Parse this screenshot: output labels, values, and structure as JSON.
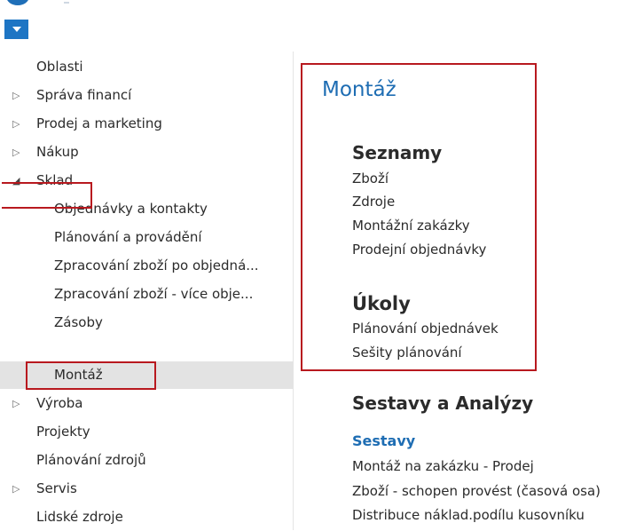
{
  "nav": {
    "items": [
      {
        "label": "Oblasti",
        "arrow": ""
      },
      {
        "label": "Správa financí",
        "arrow": "▷"
      },
      {
        "label": "Prodej a marketing",
        "arrow": "▷"
      },
      {
        "label": "Nákup",
        "arrow": "▷"
      },
      {
        "label": "Sklad",
        "arrow": "◢"
      },
      {
        "label": "Objednávky a kontakty",
        "arrow": ""
      },
      {
        "label": "Plánování a provádění",
        "arrow": ""
      },
      {
        "label": "Zpracování zboží po objedná...",
        "arrow": ""
      },
      {
        "label": "Zpracování zboží - více obje...",
        "arrow": ""
      },
      {
        "label": "Zásoby",
        "arrow": ""
      },
      {
        "label": "Montáž",
        "arrow": ""
      },
      {
        "label": "Výroba",
        "arrow": "▷"
      },
      {
        "label": "Projekty",
        "arrow": ""
      },
      {
        "label": "Plánování zdrojů",
        "arrow": ""
      },
      {
        "label": "Servis",
        "arrow": "▷"
      },
      {
        "label": "Lidské zdroje",
        "arrow": ""
      }
    ]
  },
  "main": {
    "title": "Montáž",
    "lists": {
      "heading": "Seznamy",
      "items": [
        "Zboží",
        "Zdroje",
        "Montážní zakázky",
        "Prodejní objednávky"
      ]
    },
    "tasks": {
      "heading": "Úkoly",
      "items": [
        "Plánování objednávek",
        "Sešity plánování"
      ]
    },
    "reports": {
      "heading": "Sestavy a Analýzy",
      "subheading": "Sestavy",
      "items": [
        "Montáž na zakázku - Prodej",
        "Zboží - schopen provést (časová osa)",
        "Distribuce náklad.podílu kusovníku"
      ]
    }
  },
  "colors": {
    "accent": "#1e6db3",
    "highlight_box": "#b8191f",
    "selected_bg": "#e3e3e3"
  }
}
